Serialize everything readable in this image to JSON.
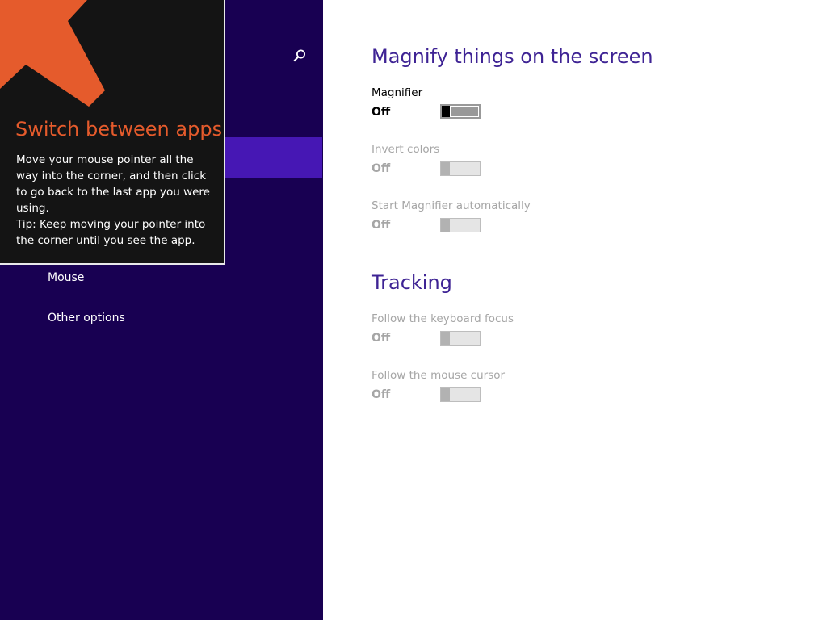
{
  "tip": {
    "title": "Switch between apps",
    "body_line1": "Move your mouse pointer all the way into the corner, and then click to go back to the last app you were using.",
    "body_line2": "Tip: Keep moving your pointer into the corner until you see the app.",
    "accent_color": "#e55b2c"
  },
  "sidebar": {
    "items": [
      {
        "label": "Mouse"
      },
      {
        "label": "Other options"
      }
    ],
    "background": "#180052",
    "selected_color": "#4617b4"
  },
  "magnify": {
    "title": "Magnify things on the screen",
    "settings": [
      {
        "label": "Magnifier",
        "state": "Off",
        "enabled": true
      },
      {
        "label": "Invert colors",
        "state": "Off",
        "enabled": false
      },
      {
        "label": "Start Magnifier automatically",
        "state": "Off",
        "enabled": false
      }
    ]
  },
  "tracking": {
    "title": "Tracking",
    "settings": [
      {
        "label": "Follow the keyboard focus",
        "state": "Off",
        "enabled": false
      },
      {
        "label": "Follow the mouse cursor",
        "state": "Off",
        "enabled": false
      }
    ]
  },
  "icons": {
    "search": "search-icon",
    "arrow": "corner-arrow-icon"
  }
}
